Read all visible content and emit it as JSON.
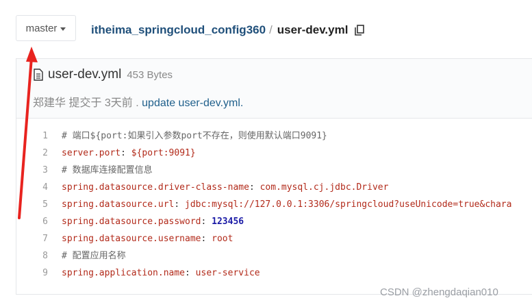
{
  "branch": {
    "label": "master"
  },
  "breadcrumb": {
    "repo": "itheima_springcloud_config360",
    "separator": "/",
    "file": "user-dev.yml"
  },
  "file": {
    "name": "user-dev.yml",
    "size": "453 Bytes",
    "author": "郑建华 提交于 3天前",
    "separator": ".",
    "commit_message": "update user-dev.yml."
  },
  "code_lines": [
    {
      "num": "1",
      "comment": "#  端口${port:如果引入参数port不存在，则使用默认端口9091}"
    },
    {
      "num": "2",
      "key": "server.port",
      "colon": ": ",
      "value": "${port:9091}"
    },
    {
      "num": "3",
      "comment": "#  数据库连接配置信息"
    },
    {
      "num": "4",
      "key": "spring.datasource.driver-class-name",
      "colon": ": ",
      "value": "com.mysql.cj.jdbc.Driver"
    },
    {
      "num": "5",
      "key": "spring.datasource.url",
      "colon": ": ",
      "value": "jdbc:mysql://127.0.0.1:3306/springcloud?useUnicode=true&chara"
    },
    {
      "num": "6",
      "key": "spring.datasource.password",
      "colon": ": ",
      "value": "123456"
    },
    {
      "num": "7",
      "key": "spring.datasource.username",
      "colon": ": ",
      "value": "root"
    },
    {
      "num": "8",
      "comment": "#  配置应用名称"
    },
    {
      "num": "9",
      "key": "spring.application.name",
      "colon": ": ",
      "value": "user-service"
    }
  ],
  "watermark": "CSDN @zhengdaqian010",
  "colors": {
    "arrow": "#e8231f",
    "link": "#1f5f8b",
    "key": "#b22a1a"
  }
}
